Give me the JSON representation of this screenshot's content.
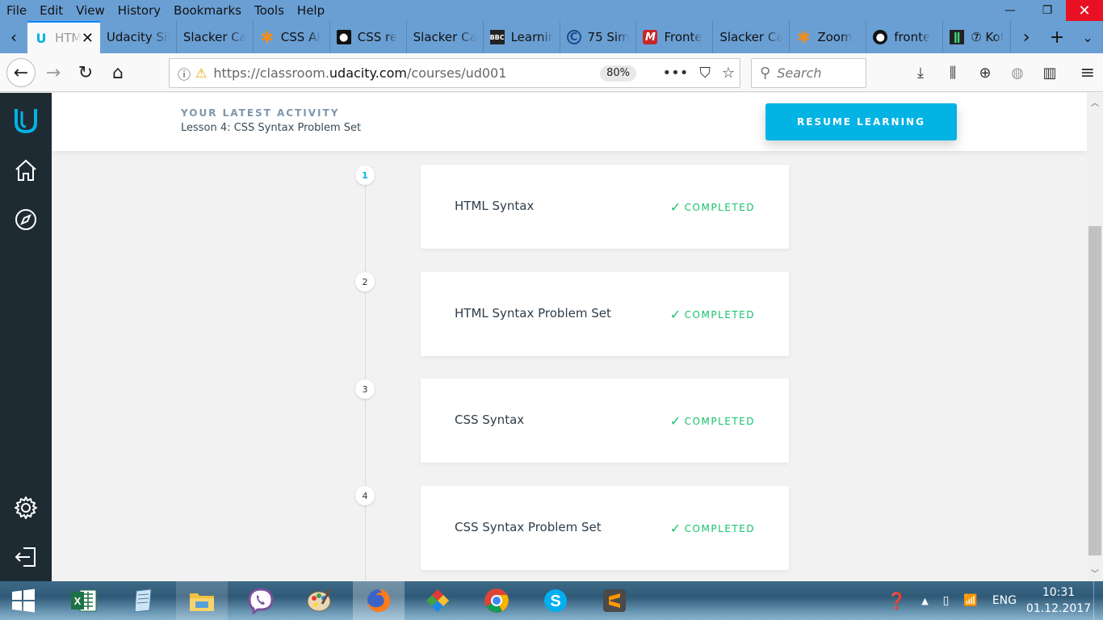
{
  "menu": [
    "File",
    "Edit",
    "View",
    "History",
    "Bookmarks",
    "Tools",
    "Help"
  ],
  "tabs": [
    {
      "label": "HTML",
      "icon": "udacity-icon",
      "active": true
    },
    {
      "label": "Udacity Sit",
      "icon": "",
      "active": false
    },
    {
      "label": "Slacker Car",
      "icon": "",
      "active": false
    },
    {
      "label": "CSS Al",
      "icon": "asterisk-icon",
      "active": false
    },
    {
      "label": "CSS re",
      "icon": "mdn-icon",
      "active": false
    },
    {
      "label": "Slacker Car",
      "icon": "",
      "active": false
    },
    {
      "label": "Learnin",
      "icon": "bbc-icon",
      "active": false
    },
    {
      "label": "75 Sim",
      "icon": "circle-icon",
      "active": false
    },
    {
      "label": "Fronte",
      "icon": "m-icon",
      "active": false
    },
    {
      "label": "Slacker Car",
      "icon": "",
      "active": false
    },
    {
      "label": "Zoom",
      "icon": "asterisk-icon",
      "active": false
    },
    {
      "label": "fronte",
      "icon": "github-icon",
      "active": false
    },
    {
      "label": "⑦ Kot",
      "icon": "bars-icon",
      "active": false
    }
  ],
  "address": {
    "prefix": "https://classroom.",
    "domain": "udacity.com",
    "path": "/courses/ud001",
    "zoom": "80%"
  },
  "search": {
    "placeholder": "Search"
  },
  "activity": {
    "label": "YOUR LATEST ACTIVITY",
    "lesson": "Lesson 4: CSS Syntax Problem Set",
    "resume": "RESUME LEARNING"
  },
  "lessons": [
    {
      "num": "1",
      "title": "HTML Syntax",
      "status": "COMPLETED"
    },
    {
      "num": "2",
      "title": "HTML Syntax Problem Set",
      "status": "COMPLETED"
    },
    {
      "num": "3",
      "title": "CSS Syntax",
      "status": "COMPLETED"
    },
    {
      "num": "4",
      "title": "CSS Syntax Problem Set",
      "status": "COMPLETED"
    }
  ],
  "taskbar": {
    "lang": "ENG",
    "time": "10:31",
    "date": "01.12.2017"
  },
  "colors": {
    "accent": "#02b3e4",
    "completed": "#15c26b",
    "sidebar": "#1f2b33",
    "chrome": "#6a9fd4"
  }
}
